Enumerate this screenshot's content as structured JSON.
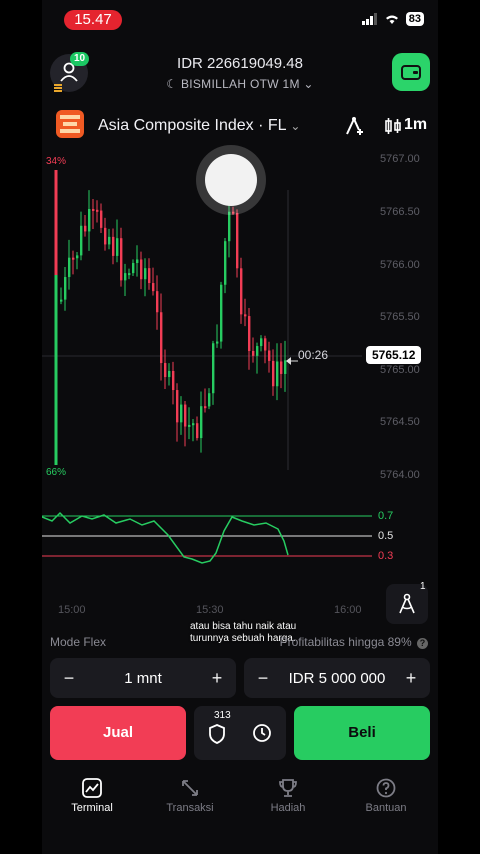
{
  "status": {
    "time": "15.47",
    "battery": "83"
  },
  "header": {
    "notification_count": "10",
    "balance": "IDR 226619049.48",
    "account": "BISMILLAH OTW 1M"
  },
  "asset": {
    "name": "Asia Composite Index · FL",
    "timeframe": "1m"
  },
  "chart": {
    "y_ticks": [
      "5767.00",
      "5766.50",
      "5766.00",
      "5765.50",
      "5765.00",
      "5764.50",
      "5764.00"
    ],
    "current_price": "5765.12",
    "countdown": "00:26",
    "sell_pct": "34%",
    "buy_pct": "66%",
    "oscillator_levels": [
      "0.7",
      "0.5",
      "0.3"
    ],
    "x_ticks": [
      "15:00",
      "15:30",
      "16:00"
    ],
    "indicator_count": "1",
    "colors": {
      "up": "#27cc61",
      "down": "#f23d55"
    }
  },
  "caption": {
    "line1": "atau bisa tahu naik atau",
    "line2": "turunnya sebuah harga."
  },
  "trade": {
    "mode": "Mode Flex",
    "profitability": "Profitabilitas hingga 89%",
    "duration": "1 mnt",
    "amount": "IDR 5 000 000",
    "minus": "−",
    "plus": "+",
    "sell": "Jual",
    "buy": "Beli",
    "shield_count": "313"
  },
  "nav": [
    {
      "label": "Terminal",
      "icon": "chart-icon"
    },
    {
      "label": "Transaksi",
      "icon": "arrows-icon"
    },
    {
      "label": "Hadiah",
      "icon": "trophy-icon"
    },
    {
      "label": "Bantuan",
      "icon": "help-icon"
    }
  ]
}
